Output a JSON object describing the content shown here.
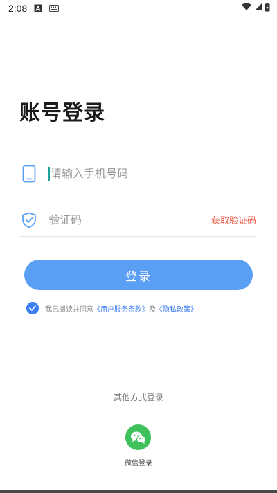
{
  "status_bar": {
    "time": "2:08",
    "icons": [
      "a-notification-icon",
      "keyboard-icon",
      "wifi-icon",
      "signal-icon",
      "battery-icon"
    ]
  },
  "page_title": "账号登录",
  "phone_field": {
    "placeholder": "请输入手机号码",
    "value": "",
    "icon": "phone-icon"
  },
  "code_field": {
    "placeholder": "验证码",
    "value": "",
    "icon": "shield-check-icon",
    "get_code_label": "获取验证码"
  },
  "login_button_label": "登录",
  "agreement": {
    "prefix": "我已阅读并同意",
    "terms_link": "《用户服务条款》",
    "conjunction": "及",
    "privacy_link": "《隐私政策》",
    "checked": true
  },
  "other_login": {
    "title": "其他方式登录",
    "wechat_label": "微信登录"
  },
  "colors": {
    "primary": "#5b9ff5",
    "link": "#3d7ef0",
    "get_code": "#e8503a",
    "wechat": "#3ec05a",
    "title": "#1b1b1b"
  }
}
